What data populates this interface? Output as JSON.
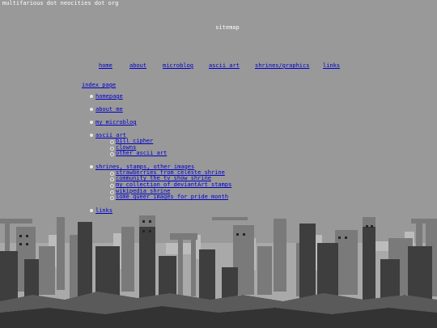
{
  "site": {
    "title": "multifarious dot neocities dot org"
  },
  "page": {
    "heading": "sitemap"
  },
  "nav": {
    "items": [
      {
        "label": "home"
      },
      {
        "label": "about"
      },
      {
        "label": "microblog"
      },
      {
        "label": "ascii art"
      },
      {
        "label": "shrines/graphics"
      },
      {
        "label": "links"
      }
    ]
  },
  "sitemap": {
    "index_label": "index page",
    "sections": [
      {
        "label": "homepage",
        "children": []
      },
      {
        "label": "about me",
        "children": []
      },
      {
        "label": "my microblog",
        "children": []
      },
      {
        "label": "ascii art",
        "children": [
          "bill cipher",
          "clowns",
          "other ascii art"
        ]
      },
      {
        "label": "shrines, stamps, other images",
        "children": [
          "strawberries from celeste shrine",
          "community the tv show shrine",
          "my collection of deviantArt stamps",
          "wikipedia shrine",
          "some queer images for pride month"
        ]
      },
      {
        "label": "links",
        "children": []
      }
    ]
  },
  "colors": {
    "background": "#999999",
    "link": "#0000cc",
    "text": "#ffffff",
    "bullet": "#e6e6e6",
    "skyline_dark": "#2a2a2a",
    "skyline_mid": "#4f4f4f",
    "skyline_light": "#b9b9b9"
  },
  "decor": {
    "background_image": "pixel-art-city-ruins-skyline"
  }
}
